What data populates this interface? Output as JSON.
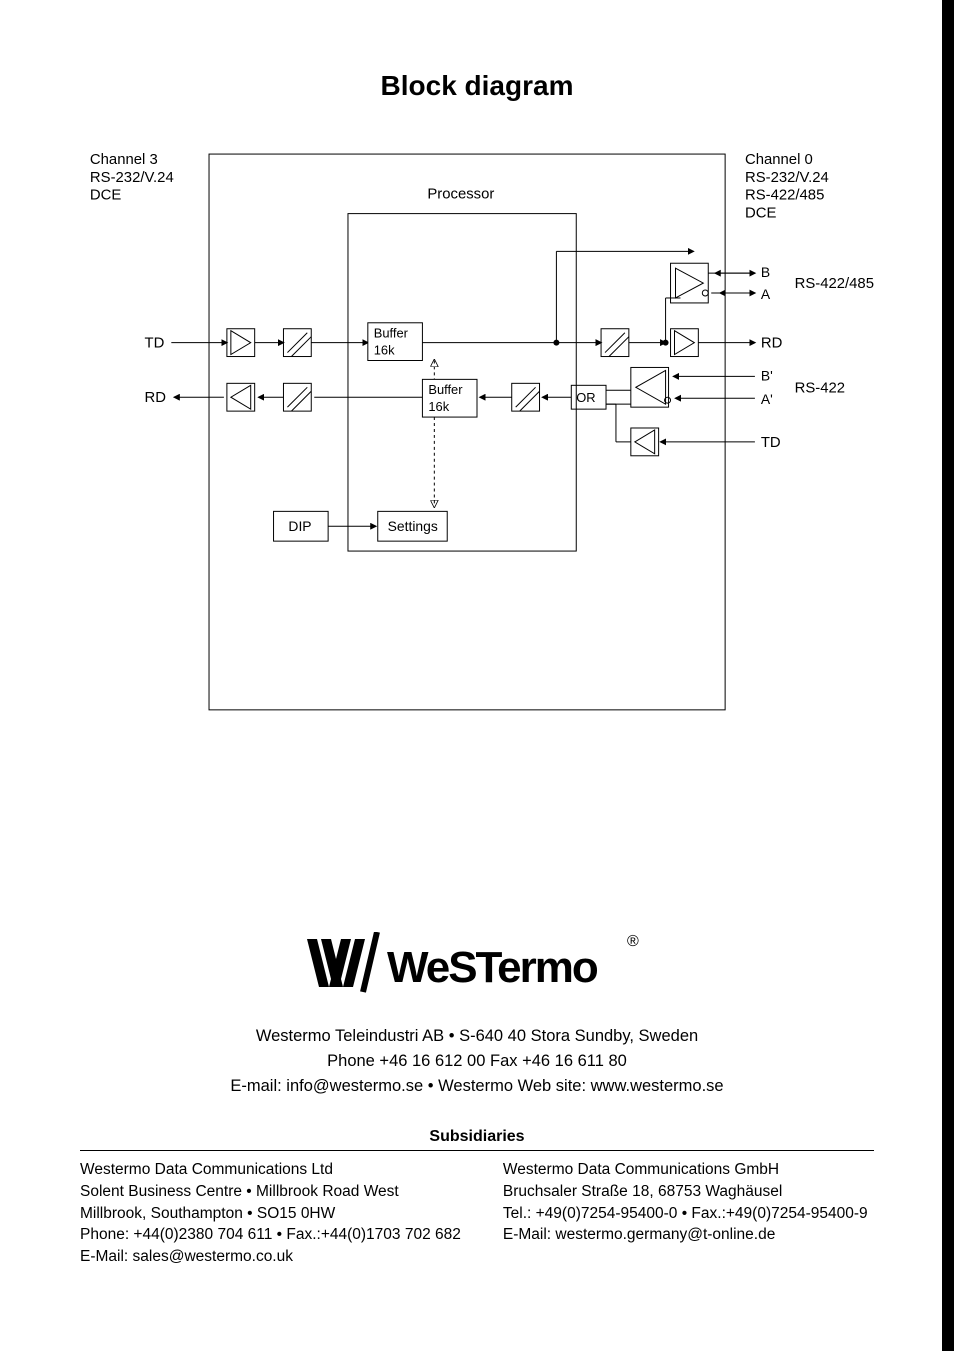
{
  "title": "Block diagram",
  "diagram": {
    "channel3": {
      "line1": "Channel 3",
      "line2": "RS-232/V.24",
      "line3": "DCE",
      "td": "TD",
      "rd": "RD"
    },
    "channel0": {
      "line1": "Channel 0",
      "line2": "RS-232/V.24",
      "line3": "RS-422/485",
      "line4": "DCE",
      "rs422_485": "RS-422/485",
      "rs422": "RS-422",
      "rd": "RD",
      "td": "TD",
      "b": "B",
      "a": "A",
      "bp": "B'",
      "ap": "A'"
    },
    "processor": "Processor",
    "buffer_top": {
      "l1": "Buffer",
      "l2": "16k"
    },
    "buffer_bot": {
      "l1": "Buffer",
      "l2": "16k"
    },
    "or": "OR",
    "dip": "DIP",
    "settings": "Settings"
  },
  "hq": {
    "line1": "Westermo Teleindustri AB • S-640 40 Stora Sundby, Sweden",
    "line2": "Phone +46 16 612 00  Fax +46 16 611 80",
    "line3": "E-mail: info@westermo.se • Westermo Web site: www.westermo.se"
  },
  "subs_heading": "Subsidiaries",
  "sub_uk": {
    "l1": "Westermo Data Communications Ltd",
    "l2": "Solent Business Centre • Millbrook Road West",
    "l3": "Millbrook, Southampton • SO15 0HW",
    "l4": "Phone: +44(0)2380 704 611 • Fax.:+44(0)1703 702 682",
    "l5": "E-Mail: sales@westermo.co.uk"
  },
  "sub_de": {
    "l1": "Westermo Data Communications GmbH",
    "l2": "Bruchsaler Straße 18, 68753 Waghäusel",
    "l3": "Tel.: +49(0)7254-95400-0 • Fax.:+49(0)7254-95400-9",
    "l4": "E-Mail: westermo.germany@t-online.de"
  },
  "logo_text": "Westermo"
}
